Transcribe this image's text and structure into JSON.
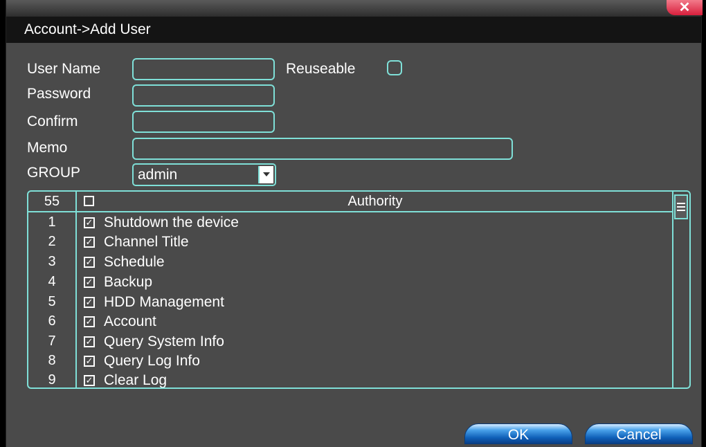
{
  "window": {
    "title": "Account->Add User",
    "close_icon": "close-icon"
  },
  "form": {
    "user_name_label": "User Name",
    "user_name_value": "",
    "reuseable_label": "Reuseable",
    "reuseable_checked": false,
    "password_label": "Password",
    "password_value": "",
    "confirm_label": "Confirm",
    "confirm_value": "",
    "memo_label": "Memo",
    "memo_value": "",
    "group_label": "GROUP",
    "group_value": "admin"
  },
  "table": {
    "count": "55",
    "header": "Authority",
    "rows": [
      {
        "num": "1",
        "name": "Shutdown the device",
        "checked": true
      },
      {
        "num": "2",
        "name": "Channel Title",
        "checked": true
      },
      {
        "num": "3",
        "name": "Schedule",
        "checked": true
      },
      {
        "num": "4",
        "name": "Backup",
        "checked": true
      },
      {
        "num": "5",
        "name": "HDD Management",
        "checked": true
      },
      {
        "num": "6",
        "name": "Account",
        "checked": true
      },
      {
        "num": "7",
        "name": "Query System Info",
        "checked": true
      },
      {
        "num": "8",
        "name": "Query Log Info",
        "checked": true
      },
      {
        "num": "9",
        "name": "Clear Log",
        "checked": true
      }
    ]
  },
  "buttons": {
    "ok": "OK",
    "cancel": "Cancel"
  },
  "colors": {
    "accent": "#7fe0d8",
    "panel": "#4a4a4a",
    "button": "#1a6fd0",
    "close": "#d81f3c"
  }
}
